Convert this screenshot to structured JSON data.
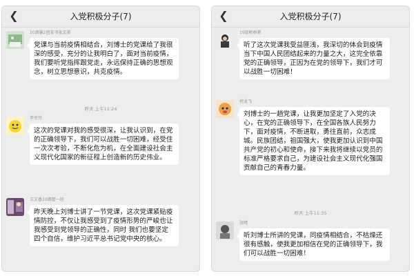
{
  "left_panel": {
    "back_icon": "chevron-left-icon",
    "title": "入党积极分子(7)",
    "messages": [
      {
        "sender": "20酒馨2团支书张文英",
        "text": "党课与当前疫情相结合，刘博士的党课给了我很深的感受，充分的让我明白了，面对当前疫情，我们要听党指挥跟党走，永远保持正确的思想观念，树立思想意识，共克疫情。"
      },
      {
        "timestamp": "昨天 上午11:24"
      },
      {
        "sender": "李幸玲",
        "text": "这次的党课对我的感受很深，让我认识到，在党的正确领导下，我们可以战胜一切困难，经受住一次次考验，不断化危为机，在全面建设社会主义现代化国家的新征程上创造新的历史伟业。"
      },
      {
        "sender": "王文香20酒管一班",
        "text": "昨天晚上刘博士讲了一节党课，这次党课紧贴疫情防控，不仅让我感受到了疫情形势的严峻也让我感受到党领导的正确性，同时 我们也要坚定四个自信，维护习近平总书记党中央的核心。"
      }
    ]
  },
  "right_panel": {
    "back_icon": "chevron-left-icon",
    "title": "入党积极分子(7)",
    "messages": [
      {
        "sender": "19旅韩林艳",
        "text": "听了这次党课我受益匪浅，我深切的体会到疫情当下中国人民团结起来的力量之大，这完全依靠党的正确领导，正因为在党的领导下，我们才可以战胜一切困难！"
      },
      {
        "sender": "柯龙飞",
        "text": "刘博士的一趟党课，让我更加坚定了入党的决心，在党的正确领导下，在全国各族人民努力下，面对疫情，不断进取，勇往直前，众志成城。民族团结，祖国强大，使我更加认识到中国共产党的初心和使命，接下来我将继续以党员的标准严格要求自己，为建设社会主义现代化强国贡献自己的青春力量。"
      },
      {
        "timestamp": "昨天 上午11:35"
      },
      {
        "sender": "张晴",
        "text": "听刘博士所讲的党课，同疫情相结合，不枯燥还很有感触，使我更加相信在党的正确领导下，我们可以战胜一切困难！"
      }
    ]
  }
}
